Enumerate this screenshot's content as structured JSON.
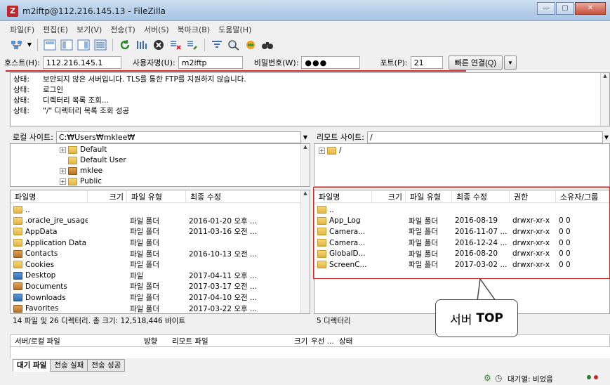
{
  "window": {
    "title": "m2iftp@112.216.145.13 - FileZilla",
    "controls": [
      "—",
      "▢",
      "✕"
    ]
  },
  "menu": [
    "파일(F)",
    "편집(E)",
    "보기(V)",
    "전송(T)",
    "서버(S)",
    "북마크(B)",
    "도움말(H)"
  ],
  "toolbar": [
    "site-manager-icon",
    "toggle-log-icon",
    "toggle-local-tree-icon",
    "toggle-remote-tree-icon",
    "toggle-queue-icon",
    "refresh-icon",
    "process-queue-icon",
    "cancel-icon",
    "disconnect-icon",
    "reconnect-icon",
    "filter-icon",
    "compare-icon",
    "sync-browse-icon",
    "search-icon"
  ],
  "quickconnect": {
    "host_label": "호스트(H):",
    "host_value": "112.216.145.1",
    "user_label": "사용자명(U):",
    "user_value": "m2iftp",
    "pass_label": "비밀번호(W):",
    "pass_value": "●●●",
    "port_label": "포트(P):",
    "port_value": "21",
    "connect_label": "빠른 연결(Q)",
    "dropdown": "▼"
  },
  "log": [
    {
      "label": "상태:",
      "text": "보안되지 않은 서버입니다. TLS를 통한 FTP를 지원하지 않습니다."
    },
    {
      "label": "상태:",
      "text": "로그인"
    },
    {
      "label": "상태:",
      "text": "디렉터리 목록 조회..."
    },
    {
      "label": "상태:",
      "text": "\"/\" 디렉터리 목록 조회 성공"
    }
  ],
  "local": {
    "site_label": "로컬 사이트:",
    "path": "C:₩Users₩mklee₩",
    "tree": [
      {
        "name": "Default",
        "expandable": true
      },
      {
        "name": "Default User",
        "expandable": false
      },
      {
        "name": "mklee",
        "expandable": true
      },
      {
        "name": "Public",
        "expandable": true
      }
    ],
    "columns": [
      "파일명",
      "크기",
      "파일 유형",
      "최종 수정"
    ],
    "files": [
      {
        "name": "..",
        "size": "",
        "type": "",
        "modified": ""
      },
      {
        "name": ".oracle_jre_usage",
        "size": "",
        "type": "파일 폴더",
        "modified": "2016-01-20 오후 ..."
      },
      {
        "name": "AppData",
        "size": "",
        "type": "파일 폴더",
        "modified": "2011-03-16 오전 ..."
      },
      {
        "name": "Application Data",
        "size": "",
        "type": "파일 폴더",
        "modified": ""
      },
      {
        "name": "Contacts",
        "size": "",
        "type": "파일 폴더",
        "modified": "2016-10-13 오전 ..."
      },
      {
        "name": "Cookies",
        "size": "",
        "type": "파일 폴더",
        "modified": ""
      },
      {
        "name": "Desktop",
        "size": "",
        "type": "파일",
        "modified": "2017-04-11 오후 ..."
      },
      {
        "name": "Documents",
        "size": "",
        "type": "파일 폴더",
        "modified": "2017-03-17 오전 ..."
      },
      {
        "name": "Downloads",
        "size": "",
        "type": "파일 폴더",
        "modified": "2017-04-10 오전 ..."
      },
      {
        "name": "Favorites",
        "size": "",
        "type": "파일 폴더",
        "modified": "2017-03-22 오후 ..."
      }
    ],
    "status": "14 파일 및 26 디렉터리. 총 크기: 12,518,446 바이트"
  },
  "remote": {
    "site_label": "리모트 사이트:",
    "path": "/",
    "tree": [
      {
        "name": "/",
        "expandable": true
      }
    ],
    "columns": [
      "파일명",
      "크기",
      "파일 유형",
      "최종 수정",
      "권한",
      "소유자/그룹"
    ],
    "files": [
      {
        "name": "..",
        "size": "",
        "type": "",
        "modified": "",
        "perm": "",
        "owner": ""
      },
      {
        "name": "App_Log",
        "size": "",
        "type": "파일 폴더",
        "modified": "2016-08-19",
        "perm": "drwxr-xr-x",
        "owner": "0 0"
      },
      {
        "name": "Camera...",
        "size": "",
        "type": "파일 폴더",
        "modified": "2016-11-07 ...",
        "perm": "drwxr-xr-x",
        "owner": "0 0"
      },
      {
        "name": "Camera...",
        "size": "",
        "type": "파일 폴더",
        "modified": "2016-12-24 ...",
        "perm": "drwxr-xr-x",
        "owner": "0 0"
      },
      {
        "name": "GlobalD...",
        "size": "",
        "type": "파일 폴더",
        "modified": "2016-08-20",
        "perm": "drwxr-xr-x",
        "owner": "0 0"
      },
      {
        "name": "ScreenC...",
        "size": "",
        "type": "파일 폴더",
        "modified": "2017-03-02 ...",
        "perm": "drwxr-xr-x",
        "owner": "0 0"
      }
    ],
    "status": "5 디렉터리"
  },
  "queue": {
    "columns": [
      "서버/로컬 파일",
      "방향",
      "리모트 파일",
      "크기",
      "우선 ...",
      "상태"
    ],
    "tabs": [
      "대기 파일",
      "전송 실패",
      "전송 성공"
    ],
    "queue_status": "대기열: 비었음"
  },
  "annotation": {
    "prefix": "서버",
    "strong": "TOP"
  }
}
